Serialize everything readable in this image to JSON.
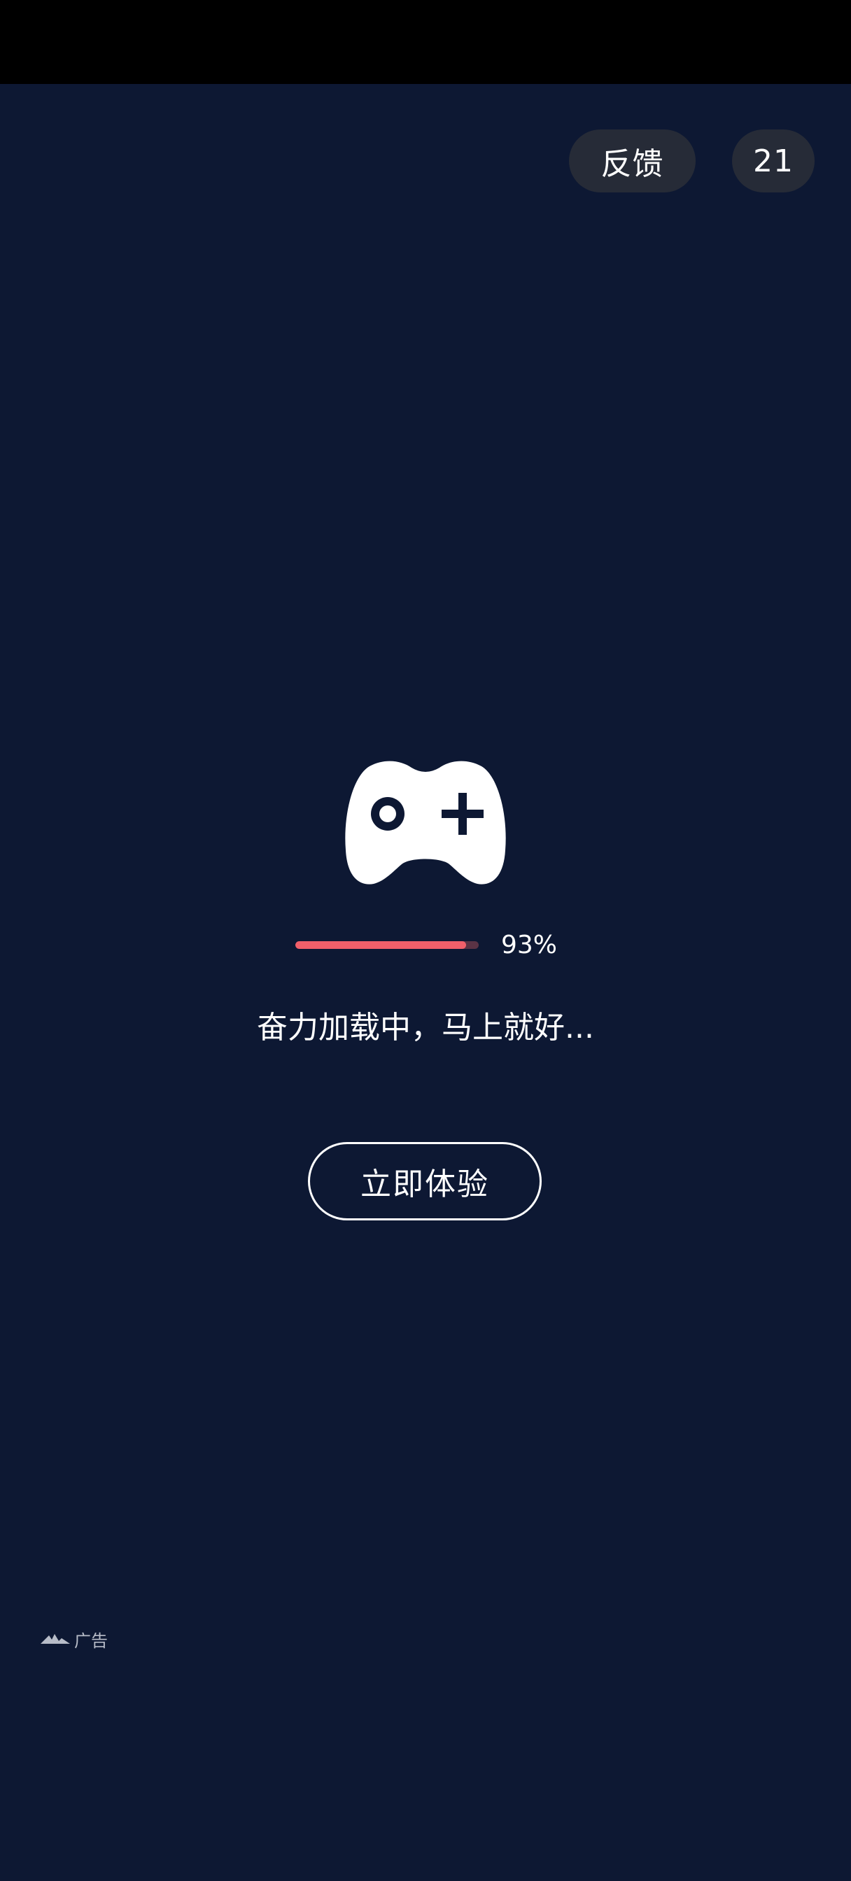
{
  "header": {
    "feedback_label": "反馈",
    "countdown": "21"
  },
  "loading": {
    "progress": 0.93,
    "percent_label": "93%",
    "message": "奋力加载中，马上就好..."
  },
  "cta": {
    "label": "立即体验"
  },
  "ad": {
    "label": "广告",
    "icon": "ad-logo-icon"
  },
  "colors": {
    "background": "#0d1833",
    "progress_fill": "#f05f6a",
    "progress_track": "#5a3345",
    "pill_bg": "#262b37"
  }
}
